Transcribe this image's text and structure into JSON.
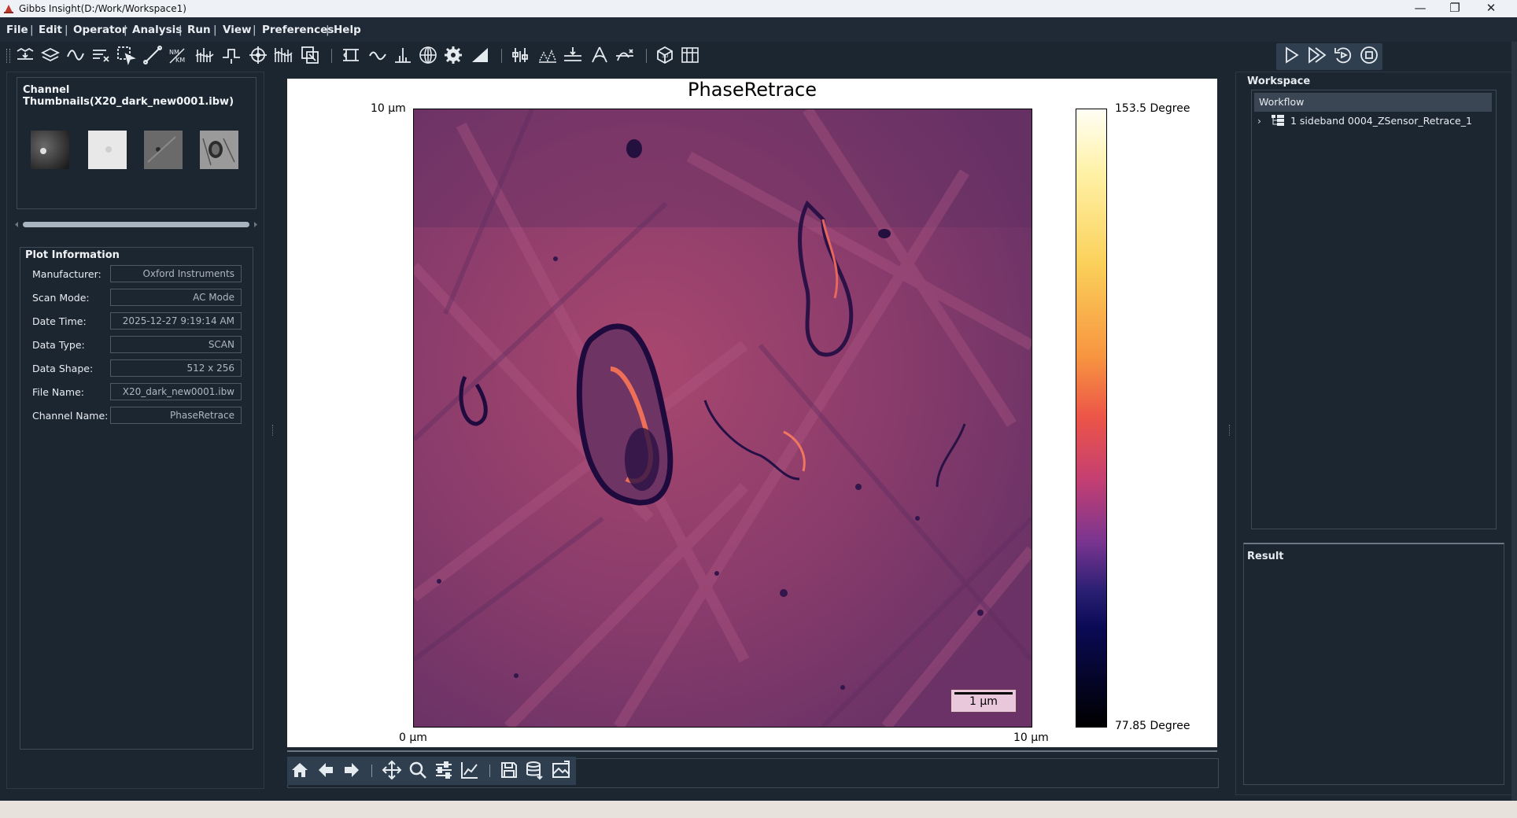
{
  "window": {
    "title": "Gibbs Insight(D:/Work/Workspace1)",
    "minimize_glyph": "—",
    "maximize_glyph": "❐",
    "close_glyph": "✕"
  },
  "menu": [
    "File",
    "Edit",
    "Operator",
    "Analysis",
    "Run",
    "View",
    "Preferences",
    "Help"
  ],
  "menu_separator": "|",
  "thumbnails": {
    "title": "Channel Thumbnails(X20_dark_new0001.ibw)"
  },
  "plot_info": {
    "title": "Plot Information",
    "rows": [
      {
        "label": "Manufacturer:",
        "value": "Oxford Instruments"
      },
      {
        "label": "Scan Mode:",
        "value": "AC Mode"
      },
      {
        "label": "Date Time:",
        "value": "2025-12-27 9:19:14 AM"
      },
      {
        "label": "Data Type:",
        "value": "SCAN"
      },
      {
        "label": "Data Shape:",
        "value": "512 x 256"
      },
      {
        "label": "File Name:",
        "value": "X20_dark_new0001.ibw"
      },
      {
        "label": "Channel Name:",
        "value": "PhaseRetrace"
      }
    ]
  },
  "plot": {
    "title": "PhaseRetrace",
    "y_top_label": "10 µm",
    "x_left_label": "0 µm",
    "x_right_label": "10 µm",
    "colorbar_max": "153.5 Degree",
    "colorbar_min": "77.85 Degree",
    "scalebar_label": "1 µm"
  },
  "workspace": {
    "title": "Workspace",
    "workflow_header": "Workflow",
    "tree_item": "1 sideband 0004_ZSensor_Retrace_1",
    "tree_arrow": "›"
  },
  "result": {
    "title": "Result"
  },
  "colors": {
    "panel_bg": "#1c2631",
    "menubar_bg": "#1f2a36",
    "run_box": "#2f3f50",
    "image_base": "#823a6a"
  }
}
